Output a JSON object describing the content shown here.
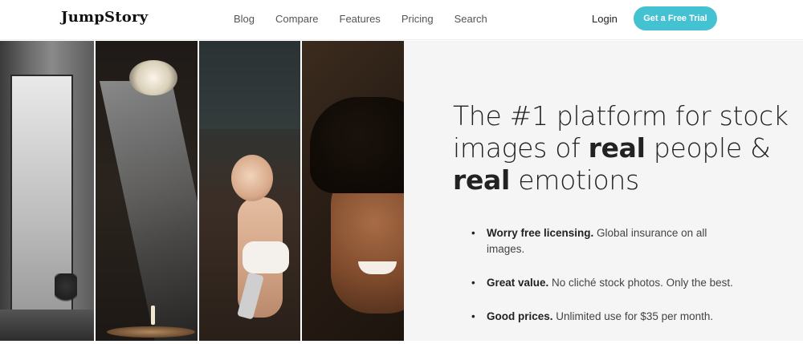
{
  "header": {
    "logo": "JumpStory",
    "nav": [
      {
        "label": "Blog"
      },
      {
        "label": "Compare"
      },
      {
        "label": "Features"
      },
      {
        "label": "Pricing"
      },
      {
        "label": "Search"
      }
    ],
    "login": "Login",
    "cta": "Get a Free Trial"
  },
  "colors": {
    "accent": "#44c2d2",
    "content_bg": "#f5f5f5"
  },
  "hero": {
    "headline_part1": "The #1 platform for stock images of ",
    "headline_bold1": "real",
    "headline_part2": " people & ",
    "headline_bold2": "real",
    "headline_part3": " emotions",
    "bullets": [
      {
        "bold": "Worry free licensing.",
        "text": " Global insurance on all images."
      },
      {
        "bold": "Great value.",
        "text": " No cliché stock photos. Only the best."
      },
      {
        "bold": "Good prices.",
        "text": " Unlimited use for $35 per month."
      }
    ]
  }
}
